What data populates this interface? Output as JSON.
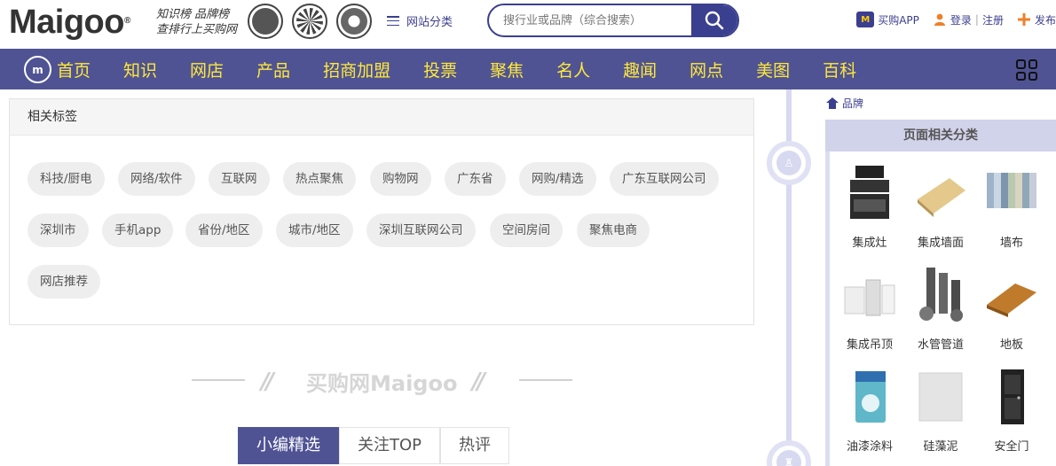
{
  "header": {
    "logo": "Maigoo",
    "logo_mark": "®",
    "slogan_line1": "知识榜 品牌榜",
    "slogan_line2": "查排行上买购网",
    "category_link": "网站分类",
    "search_placeholder": "搜行业或品牌（综合搜索）",
    "app_label": "买购APP",
    "app_icon_text": "M",
    "login": "登录",
    "register": "注册",
    "publish": "发布"
  },
  "nav": {
    "logo_text": "m",
    "items": [
      "首页",
      "知识",
      "网店",
      "产品",
      "招商加盟",
      "投票",
      "聚焦",
      "名人",
      "趣闻",
      "网点",
      "美图",
      "百科"
    ]
  },
  "tags_panel": {
    "title": "相关标签",
    "tags": [
      "科技/厨电",
      "网络/软件",
      "互联网",
      "热点聚焦",
      "购物网",
      "广东省",
      "网购/精选",
      "广东互联网公司",
      "深圳市",
      "手机app",
      "省份/地区",
      "城市/地区",
      "深圳互联网公司",
      "空间房间",
      "聚焦电商",
      "网店推荐"
    ]
  },
  "brand_footer": {
    "text": "买购网Maigoo"
  },
  "tabs": [
    "小编精选",
    "关注TOP",
    "热评"
  ],
  "breadcrumb": "品牌",
  "side_panel": {
    "title": "页面相关分类",
    "items": [
      "集成灶",
      "集成墙面",
      "墙布",
      "集成吊顶",
      "水管管道",
      "地板",
      "油漆涂料",
      "硅藻泥",
      "安全门"
    ]
  },
  "colors": {
    "primary": "#4f5394",
    "nav_text": "#ffe83a",
    "tag_bg": "#eeeeee"
  }
}
